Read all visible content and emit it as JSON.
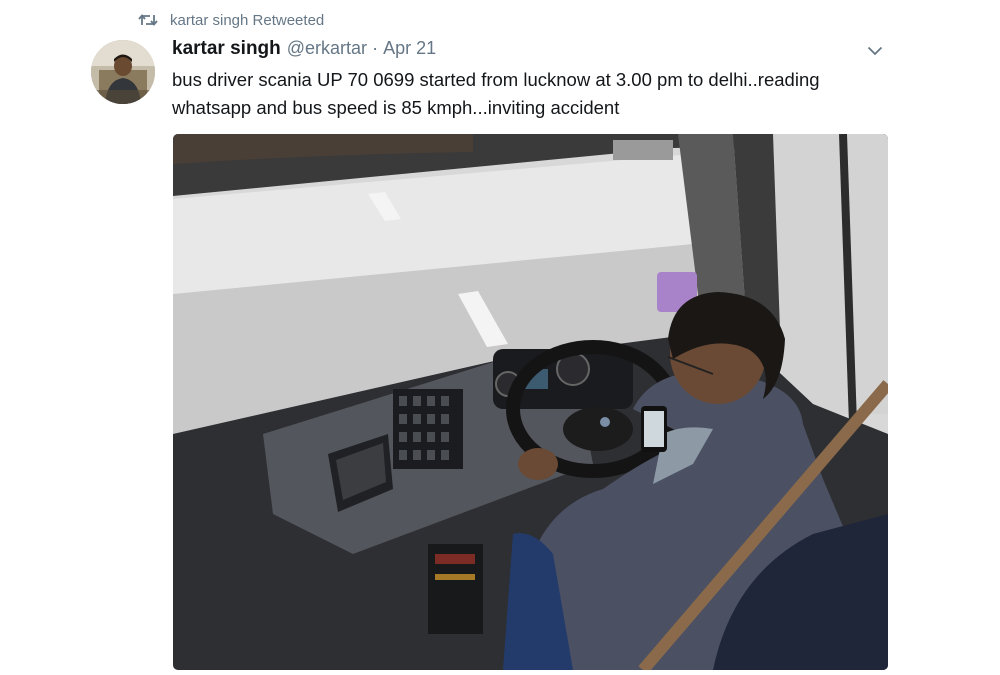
{
  "retweet": {
    "icon": "retweet-icon",
    "text": "kartar singh Retweeted"
  },
  "tweet": {
    "author_name": "kartar singh",
    "author_handle": "@erkartar",
    "separator": "·",
    "date": "Apr 21",
    "text": "bus driver scania UP 70 0699 started from lucknow at 3.00 pm  to delhi..reading whatsapp and bus speed is 85 kmph...inviting accident",
    "menu_icon": "chevron-down-icon",
    "media_icon": "photo-bus-driver-on-phone"
  },
  "colors": {
    "text_primary": "#14171a",
    "text_secondary": "#657786",
    "background_column": "#f5f8fa"
  }
}
